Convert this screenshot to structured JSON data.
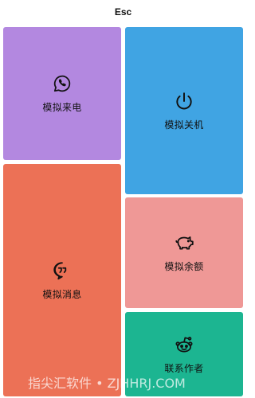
{
  "header": {
    "title": "Esc"
  },
  "tiles": [
    {
      "id": "call",
      "label": "模拟来电",
      "icon": "whatsapp-phone-icon",
      "color": "#b388e0"
    },
    {
      "id": "shutdown",
      "label": "模拟关机",
      "icon": "power-icon",
      "color": "#40a4e3"
    },
    {
      "id": "message",
      "label": "模拟消息",
      "icon": "quote-chat-icon",
      "color": "#ec7156"
    },
    {
      "id": "balance",
      "label": "模拟余额",
      "icon": "piggy-bank-icon",
      "color": "#ef9896"
    },
    {
      "id": "contact",
      "label": "联系作者",
      "icon": "reddit-icon",
      "color": "#1cb591"
    }
  ],
  "watermark": {
    "text": "指尖汇软件 • ZJHHRJ.COM"
  }
}
